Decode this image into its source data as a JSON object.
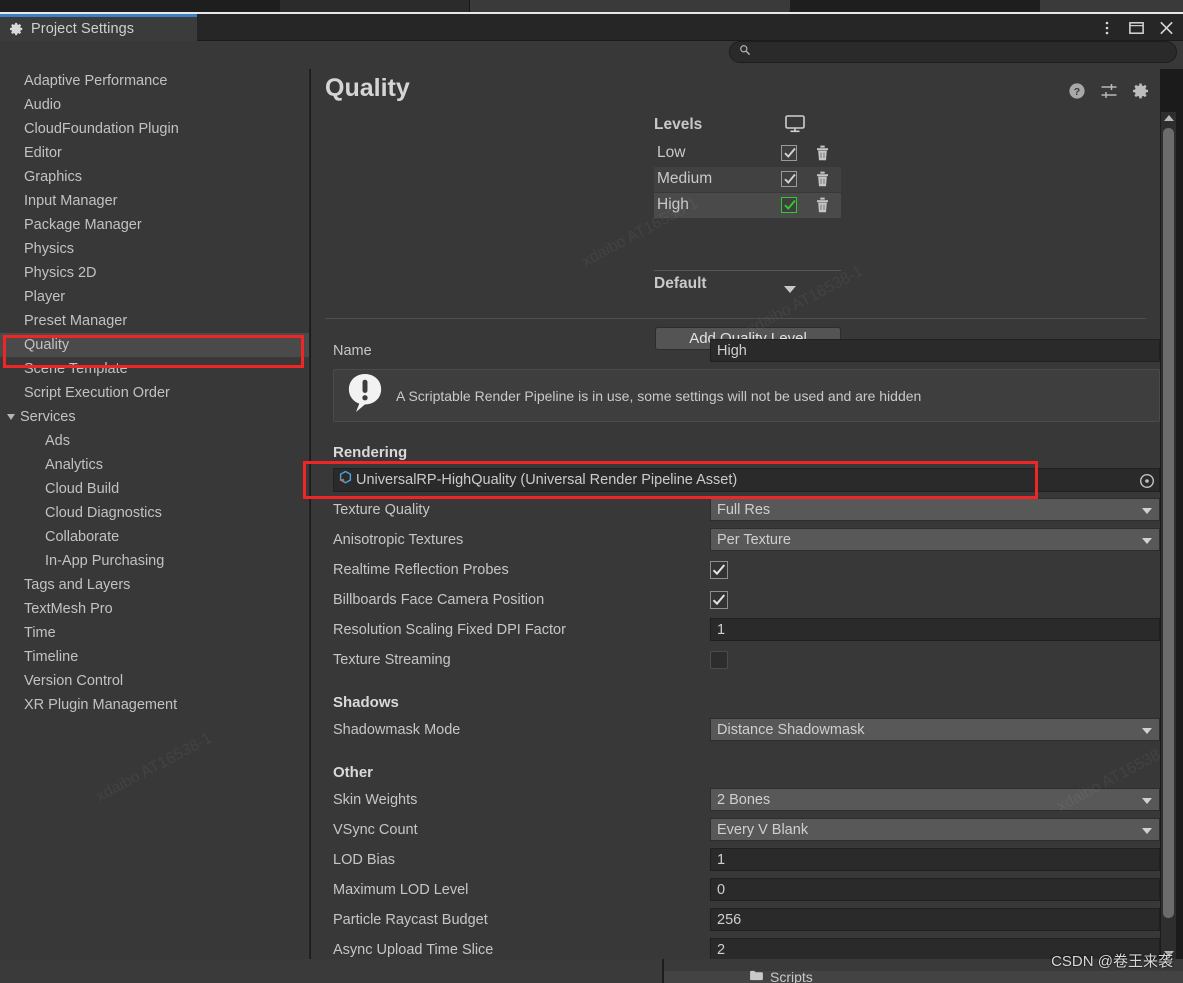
{
  "window": {
    "tab_title": "Project Settings",
    "gear_icon": "gear-icon",
    "controls": [
      {
        "name": "more-options-icon",
        "glyph": "kebab"
      },
      {
        "name": "maximize-icon",
        "glyph": "square"
      },
      {
        "name": "close-icon",
        "glyph": "x"
      }
    ]
  },
  "search": {
    "value": "",
    "placeholder": "",
    "icon": "search-icon"
  },
  "sidebar": {
    "items": [
      {
        "label": "Adaptive Performance",
        "level": 0,
        "selected": false
      },
      {
        "label": "Audio",
        "level": 0,
        "selected": false
      },
      {
        "label": "CloudFoundation Plugin",
        "level": 0,
        "selected": false
      },
      {
        "label": "Editor",
        "level": 0,
        "selected": false
      },
      {
        "label": "Graphics",
        "level": 0,
        "selected": false
      },
      {
        "label": "Input Manager",
        "level": 0,
        "selected": false
      },
      {
        "label": "Package Manager",
        "level": 0,
        "selected": false
      },
      {
        "label": "Physics",
        "level": 0,
        "selected": false
      },
      {
        "label": "Physics 2D",
        "level": 0,
        "selected": false
      },
      {
        "label": "Player",
        "level": 0,
        "selected": false
      },
      {
        "label": "Preset Manager",
        "level": 0,
        "selected": false
      },
      {
        "label": "Quality",
        "level": 0,
        "selected": true
      },
      {
        "label": "Scene Template",
        "level": 0,
        "selected": false
      },
      {
        "label": "Script Execution Order",
        "level": 0,
        "selected": false
      },
      {
        "label": "Services",
        "level": 0,
        "selected": false,
        "expandable": true,
        "expanded": true
      },
      {
        "label": "Ads",
        "level": 1,
        "selected": false
      },
      {
        "label": "Analytics",
        "level": 1,
        "selected": false
      },
      {
        "label": "Cloud Build",
        "level": 1,
        "selected": false
      },
      {
        "label": "Cloud Diagnostics",
        "level": 1,
        "selected": false
      },
      {
        "label": "Collaborate",
        "level": 1,
        "selected": false
      },
      {
        "label": "In-App Purchasing",
        "level": 1,
        "selected": false
      },
      {
        "label": "Tags and Layers",
        "level": 0,
        "selected": false
      },
      {
        "label": "TextMesh Pro",
        "level": 0,
        "selected": false
      },
      {
        "label": "Time",
        "level": 0,
        "selected": false
      },
      {
        "label": "Timeline",
        "level": 0,
        "selected": false
      },
      {
        "label": "Version Control",
        "level": 0,
        "selected": false
      },
      {
        "label": "XR Plugin Management",
        "level": 0,
        "selected": false
      }
    ]
  },
  "content": {
    "title": "Quality",
    "head_icons": [
      {
        "name": "help-icon"
      },
      {
        "name": "preset-icon"
      },
      {
        "name": "gear-icon"
      }
    ],
    "levels": {
      "header": "Levels",
      "column_icon": "monitor-icon",
      "rows": [
        {
          "name": "Low",
          "checked": true,
          "green": false,
          "highlight": false
        },
        {
          "name": "Medium",
          "checked": true,
          "green": false,
          "highlight": true
        },
        {
          "name": "High",
          "checked": true,
          "green": true,
          "highlight": true
        }
      ],
      "default_label": "Default",
      "add_button": "Add Quality Level"
    },
    "name_row": {
      "label": "Name",
      "value": "High"
    },
    "warning": {
      "icon": "warning-icon",
      "text": "A Scriptable Render Pipeline is in use, some settings will not be used and are hidden"
    },
    "sections": [
      {
        "heading": "Rendering",
        "rows": [
          {
            "type": "object",
            "label": "",
            "value": "UniversalRP-HighQuality (Universal Render Pipeline Asset)",
            "icon": "asset-cube-icon"
          },
          {
            "type": "popup",
            "label": "Texture Quality",
            "value": "Full Res"
          },
          {
            "type": "popup",
            "label": "Anisotropic Textures",
            "value": "Per Texture"
          },
          {
            "type": "checkbox",
            "label": "Realtime Reflection Probes",
            "value": true
          },
          {
            "type": "checkbox",
            "label": "Billboards Face Camera Position",
            "value": true
          },
          {
            "type": "text",
            "label": "Resolution Scaling Fixed DPI Factor",
            "value": "1"
          },
          {
            "type": "checkbox",
            "label": "Texture Streaming",
            "value": false
          }
        ]
      },
      {
        "heading": "Shadows",
        "rows": [
          {
            "type": "popup",
            "label": "Shadowmask Mode",
            "value": "Distance Shadowmask"
          }
        ]
      },
      {
        "heading": "Other",
        "rows": [
          {
            "type": "popup",
            "label": "Skin Weights",
            "value": "2 Bones"
          },
          {
            "type": "popup",
            "label": "VSync Count",
            "value": "Every V Blank"
          },
          {
            "type": "text",
            "label": "LOD Bias",
            "value": "1"
          },
          {
            "type": "text",
            "label": "Maximum LOD Level",
            "value": "0"
          },
          {
            "type": "text",
            "label": "Particle Raycast Budget",
            "value": "256"
          },
          {
            "type": "text",
            "label": "Async Upload Time Slice",
            "value": "2"
          }
        ]
      }
    ]
  },
  "bottom": {
    "folder_label": "Scripts",
    "folder_icon": "folder-icon"
  },
  "watermarks": {
    "csdn": "CSDN @卷王来袭",
    "faint": [
      "xdaibo AT16538-1",
      "xdaibo AT16538-1",
      "xdaibo AT16538-1",
      "xdaibo AT16538-1"
    ]
  },
  "annotations": {
    "color": "#ef2626",
    "boxes": [
      {
        "name": "quality-sidebar-highlight"
      },
      {
        "name": "render-pipeline-asset-highlight"
      }
    ]
  }
}
